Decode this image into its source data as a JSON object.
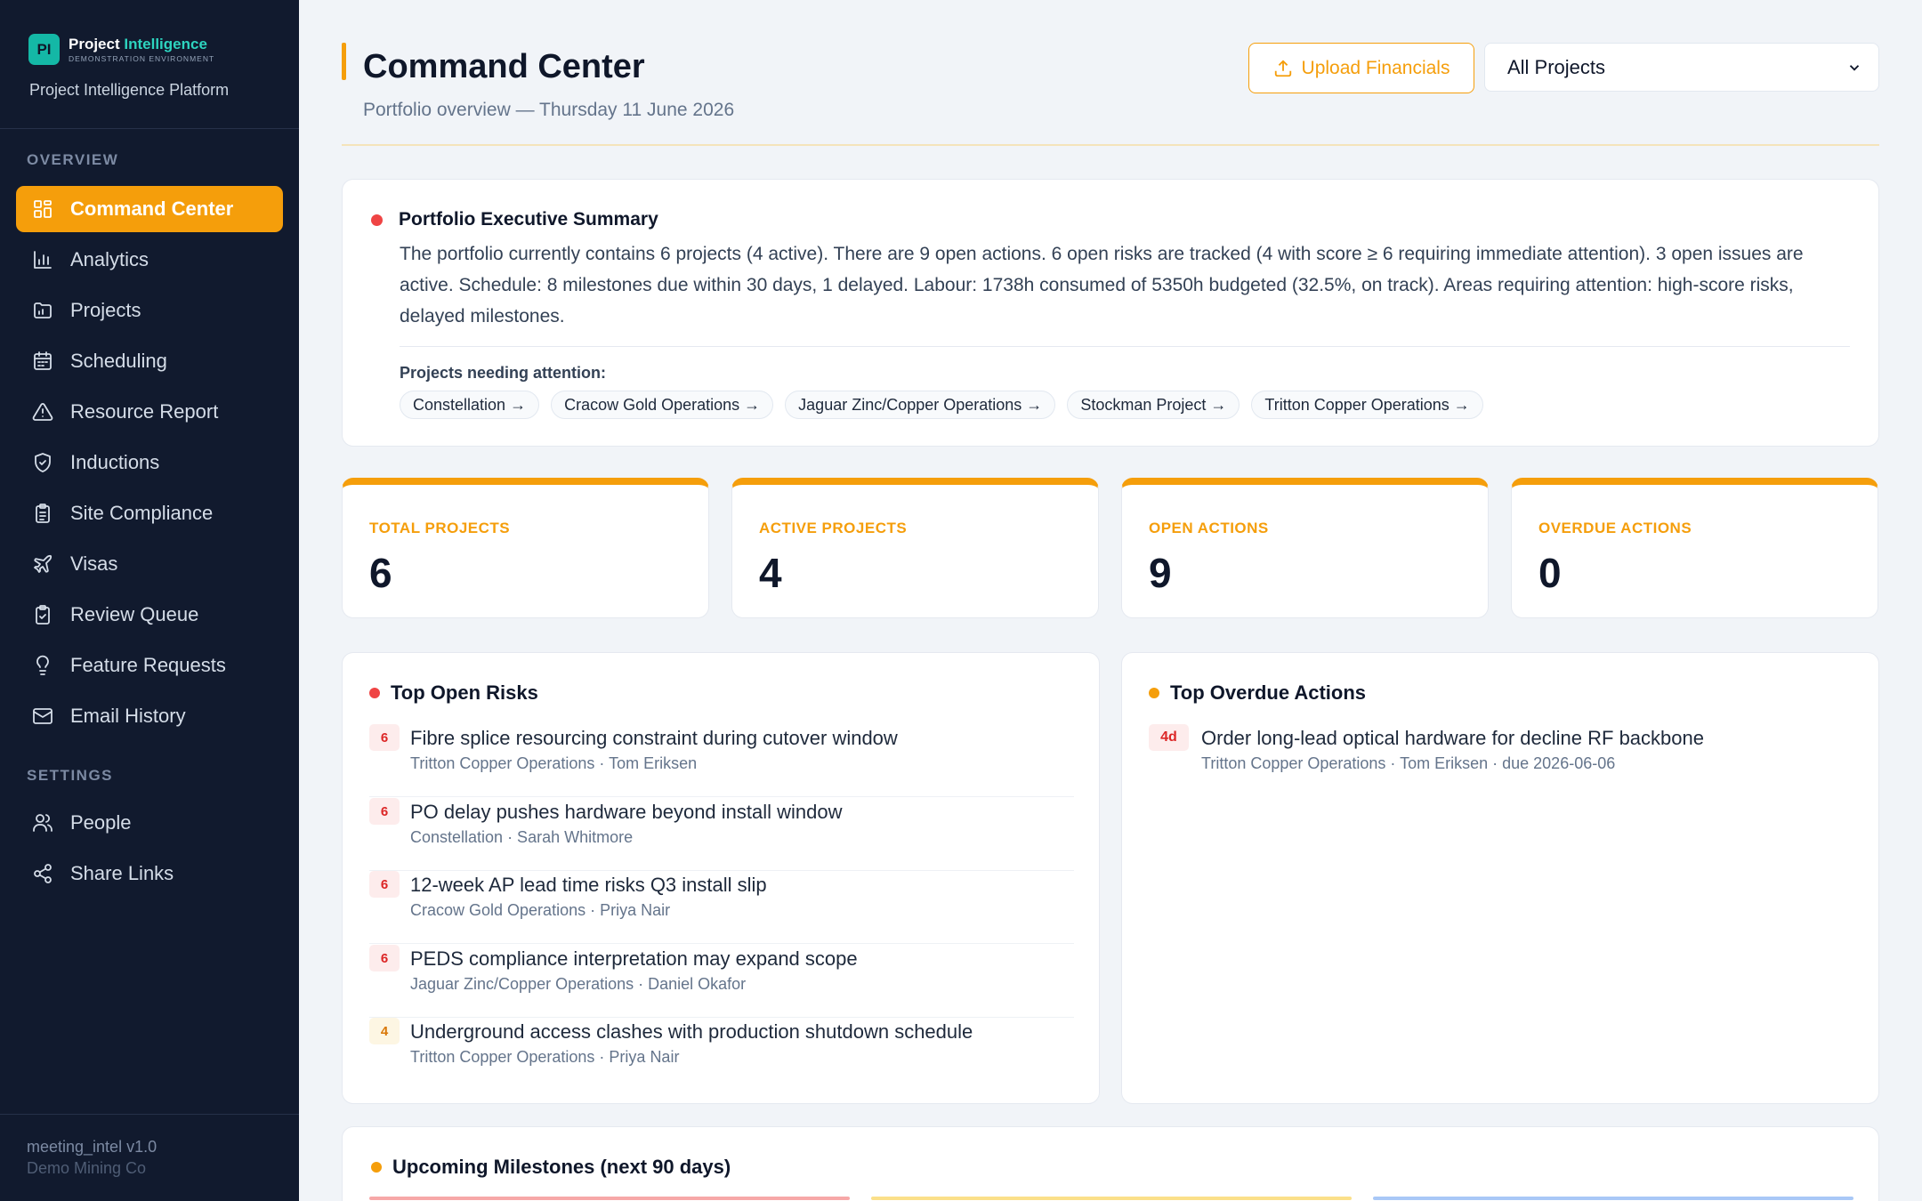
{
  "brand": {
    "logo": "PI",
    "name_part1": "Project",
    "name_part2": "Intelligence",
    "environment": "DEMONSTRATION ENVIRONMENT",
    "platform": "Project Intelligence Platform"
  },
  "sidebar": {
    "overview_label": "OVERVIEW",
    "settings_label": "SETTINGS",
    "items": [
      {
        "label": "Command Center",
        "icon": "dashboard-icon"
      },
      {
        "label": "Analytics",
        "icon": "bar-chart-icon"
      },
      {
        "label": "Projects",
        "icon": "folder-icon"
      },
      {
        "label": "Scheduling",
        "icon": "calendar-icon"
      },
      {
        "label": "Resource Report",
        "icon": "warning-triangle-icon"
      },
      {
        "label": "Inductions",
        "icon": "shield-check-icon"
      },
      {
        "label": "Site Compliance",
        "icon": "clipboard-icon"
      },
      {
        "label": "Visas",
        "icon": "plane-icon"
      },
      {
        "label": "Review Queue",
        "icon": "clipboard-check-icon"
      },
      {
        "label": "Feature Requests",
        "icon": "lightbulb-icon"
      },
      {
        "label": "Email History",
        "icon": "mail-icon"
      }
    ],
    "settings_items": [
      {
        "label": "People",
        "icon": "users-icon"
      },
      {
        "label": "Share Links",
        "icon": "share-icon"
      }
    ],
    "version": "meeting_intel v1.0",
    "company": "Demo Mining Co"
  },
  "header": {
    "title": "Command Center",
    "subtitle": "Portfolio overview — Thursday 11 June 2026",
    "upload_label": "Upload Financials",
    "project_filter": "All Projects"
  },
  "summary": {
    "title": "Portfolio Executive Summary",
    "text": "The portfolio currently contains 6 projects (4 active). There are 9 open actions. 6 open risks are tracked (4 with score ≥ 6 requiring immediate attention). 3 open issues are active. Schedule: 8 milestones due within 30 days, 1 delayed. Labour: 1738h consumed of 5350h budgeted (32.5%, on track). Areas requiring attention: high-score risks, delayed milestones.",
    "attention_label": "Projects needing attention:",
    "projects": [
      "Constellation →",
      "Cracow Gold Operations →",
      "Jaguar Zinc/Copper Operations →",
      "Stockman Project →",
      "Tritton Copper Operations →"
    ]
  },
  "stats": [
    {
      "label": "TOTAL PROJECTS",
      "value": "6"
    },
    {
      "label": "ACTIVE PROJECTS",
      "value": "4"
    },
    {
      "label": "OPEN ACTIONS",
      "value": "9"
    },
    {
      "label": "OVERDUE ACTIONS",
      "value": "0"
    }
  ],
  "risks": {
    "title": "Top Open Risks",
    "items": [
      {
        "score": "6",
        "title": "Fibre splice resourcing constraint during cutover window",
        "meta": "Tritton Copper Operations · Tom Eriksen"
      },
      {
        "score": "6",
        "title": "PO delay pushes hardware beyond install window",
        "meta": "Constellation · Sarah Whitmore"
      },
      {
        "score": "6",
        "title": "12-week AP lead time risks Q3 install slip",
        "meta": "Cracow Gold Operations · Priya Nair"
      },
      {
        "score": "6",
        "title": "PEDS compliance interpretation may expand scope",
        "meta": "Jaguar Zinc/Copper Operations · Daniel Okafor"
      },
      {
        "score": "4",
        "title": "Underground access clashes with production shutdown schedule",
        "meta": "Tritton Copper Operations · Priya Nair"
      }
    ]
  },
  "overdue": {
    "title": "Top Overdue Actions",
    "items": [
      {
        "badge": "4d",
        "title": "Order long-lead optical hardware for decline RF backbone",
        "meta": "Tritton Copper Operations · Tom Eriksen · due 2026-06-06"
      }
    ]
  },
  "milestones": {
    "title": "Upcoming Milestones (next 90 days)"
  },
  "colors": {
    "accent": "#f59e0b",
    "sidebar_bg": "#111a2e",
    "danger": "#ef4444",
    "teal": "#14b8a6"
  }
}
